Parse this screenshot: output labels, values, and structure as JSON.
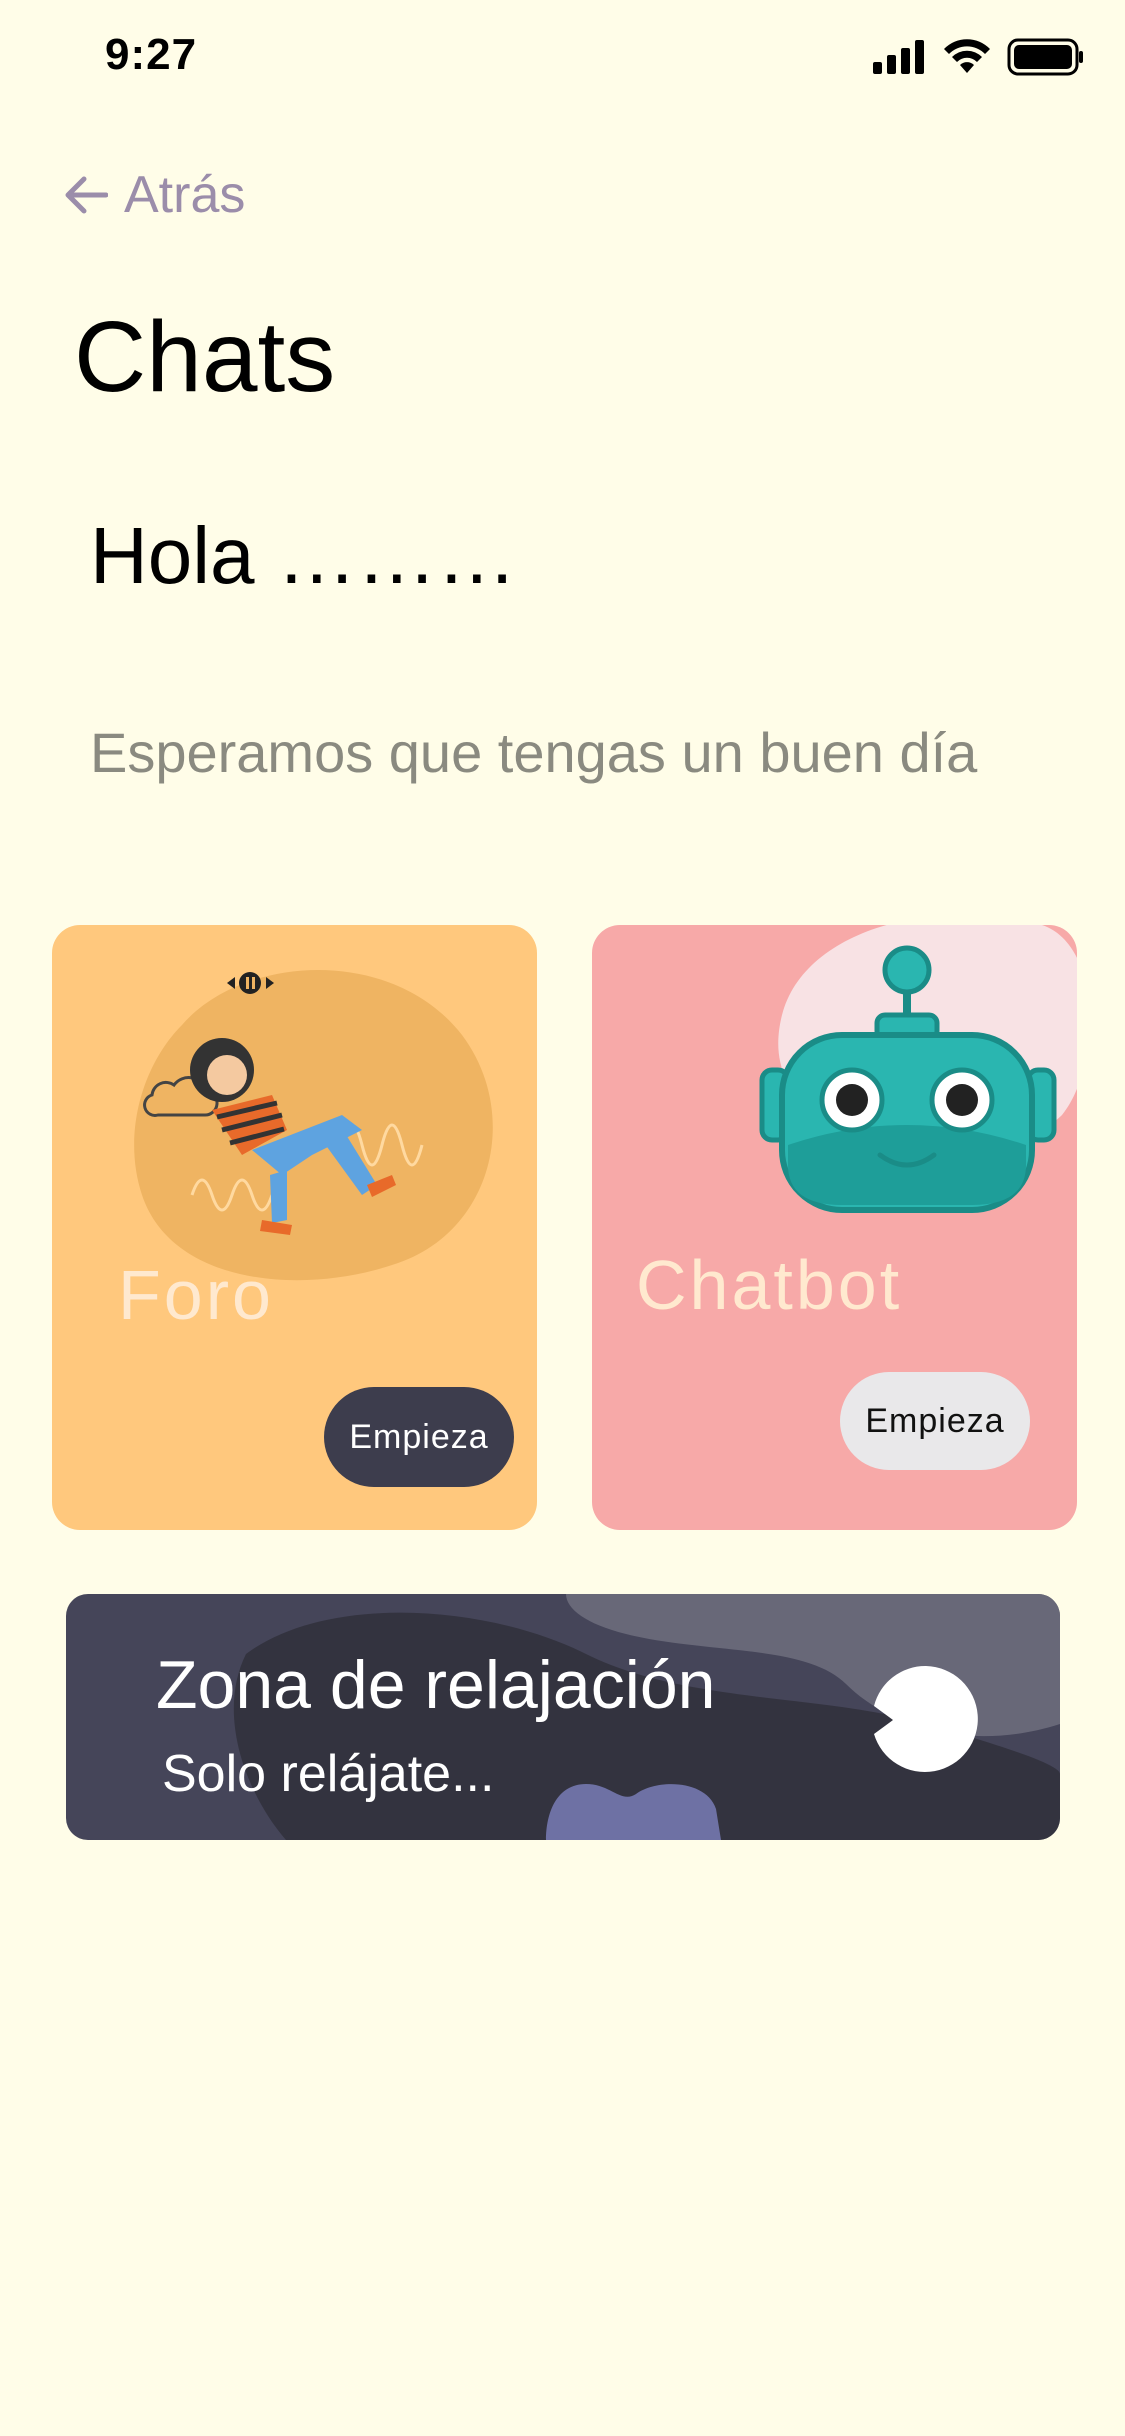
{
  "status_bar": {
    "time": "9:27"
  },
  "nav": {
    "back_label": "Atrás"
  },
  "header": {
    "title": "Chats",
    "greeting": "Hola ………",
    "subtitle": "Esperamos que tengas un buen día"
  },
  "cards": [
    {
      "label": "Foro",
      "button": "Empieza",
      "color": "#FFC87D"
    },
    {
      "label": "Chatbot",
      "button": "Empieza",
      "color": "#F7A9A8"
    }
  ],
  "relax": {
    "title": "Zona de relajación",
    "subtitle": "Solo relájate..."
  },
  "colors": {
    "background": "#FFFDE8",
    "back_link": "#9B8DAA",
    "relax_card": "#454559"
  }
}
